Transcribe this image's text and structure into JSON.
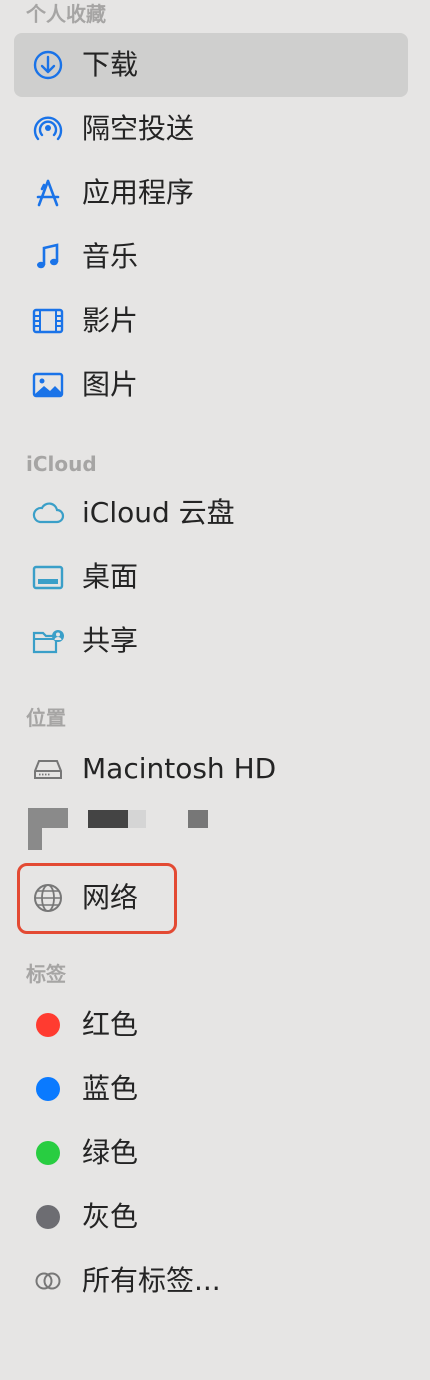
{
  "sections": {
    "favorites": "个人收藏",
    "icloud": "iCloud",
    "locations": "位置",
    "tags": "标签"
  },
  "favorites": [
    {
      "label": "下载",
      "icon": "download-icon",
      "selected": true
    },
    {
      "label": "隔空投送",
      "icon": "airdrop-icon"
    },
    {
      "label": "应用程序",
      "icon": "applications-icon"
    },
    {
      "label": "音乐",
      "icon": "music-icon"
    },
    {
      "label": "影片",
      "icon": "movies-icon"
    },
    {
      "label": "图片",
      "icon": "pictures-icon"
    }
  ],
  "icloud": [
    {
      "label": "iCloud 云盘",
      "icon": "cloud-icon"
    },
    {
      "label": "桌面",
      "icon": "desktop-icon"
    },
    {
      "label": "共享",
      "icon": "shared-folder-icon"
    }
  ],
  "locations": [
    {
      "label": "Macintosh HD",
      "icon": "hard-drive-icon"
    },
    {
      "label": "网络",
      "icon": "globe-icon",
      "highlighted": true
    }
  ],
  "tags": [
    {
      "label": "红色",
      "color": "#ff3b30"
    },
    {
      "label": "蓝色",
      "color": "#0a7aff"
    },
    {
      "label": "绿色",
      "color": "#28cd41"
    },
    {
      "label": "灰色",
      "color": "#8e8e93"
    },
    {
      "label": "所有标签...",
      "icon": "all-tags-icon"
    }
  ],
  "colors": {
    "accent": "#1a73e8",
    "highlight_border": "#e34a33"
  }
}
